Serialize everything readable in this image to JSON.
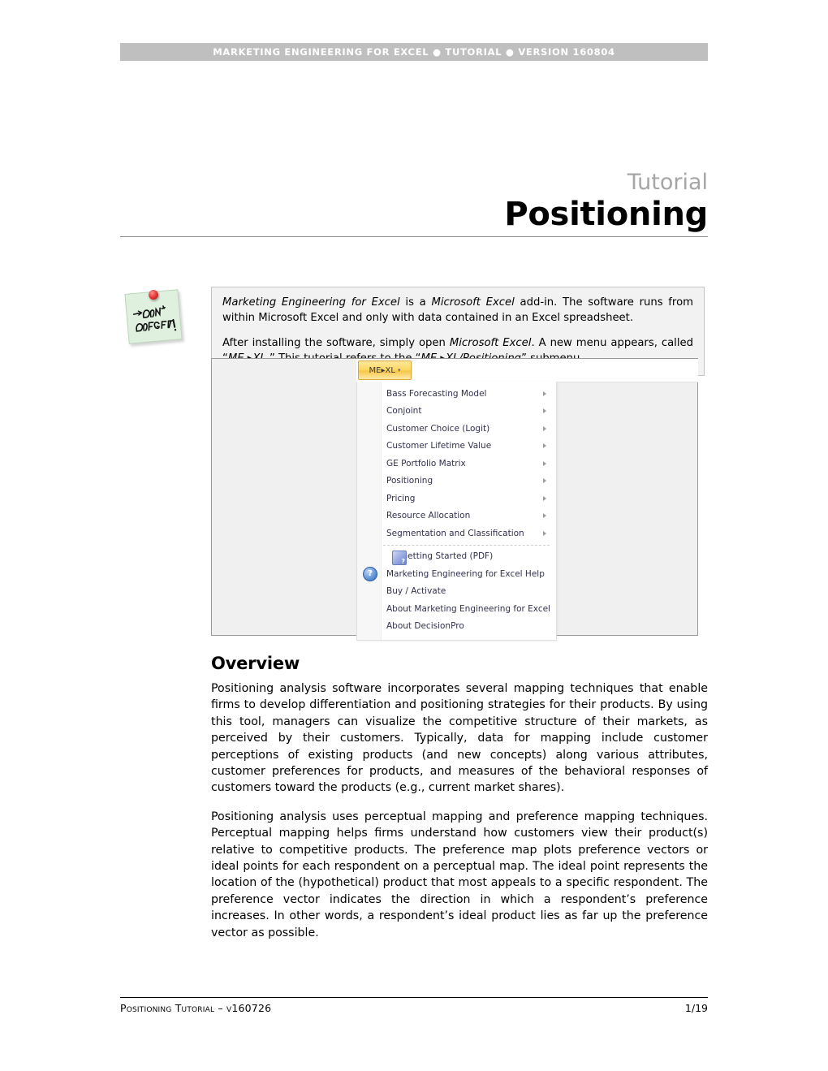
{
  "header": {
    "running_title": "MARKETING ENGINEERING FOR EXCEL  ●  TUTORIAL  ●  VERSION 160804",
    "bar_color": "#bfbfbf",
    "text_color": "#ffffff"
  },
  "title": {
    "kicker": "Tutorial",
    "main": "Positioning",
    "kicker_color": "#a6a6a6",
    "main_color": "#000000"
  },
  "note": {
    "icon_name": "dont-forget-sticky-note",
    "icon_text_line1": "DON'T",
    "icon_text_line2": "FORGET!",
    "paragraph_1_pre": "",
    "paragraph_1": {
      "i1": "Marketing Engineering for Excel",
      "t1": " is a ",
      "i2": "Microsoft Excel",
      "t2": " add-in. The software runs from within Microsoft Excel and only with data contained in an Excel spreadsheet."
    },
    "paragraph_2": {
      "t1": "After installing the software, simply open ",
      "i1": "Microsoft Excel",
      "t2": ". A new menu appears, called “",
      "i2": "ME ▸XL.",
      "t3": "” This tutorial refers to the “",
      "i3": "ME ▸XL/Positioning",
      "t4": "” submenu."
    }
  },
  "screenshot": {
    "name": "excel-me-xl-menu-screenshot",
    "ribbon_button": {
      "label": "ME▸XL",
      "caret": "▾"
    },
    "menu_items_group1": [
      {
        "label": "Bass Forecasting Model",
        "has_submenu": true
      },
      {
        "label": "Conjoint",
        "has_submenu": true
      },
      {
        "label": "Customer Choice (Logit)",
        "has_submenu": true
      },
      {
        "label": "Customer Lifetime Value",
        "has_submenu": true
      },
      {
        "label": "GE Portfolio Matrix",
        "has_submenu": true
      },
      {
        "label": "Positioning",
        "has_submenu": true
      },
      {
        "label": "Pricing",
        "has_submenu": true
      },
      {
        "label": "Resource Allocation",
        "has_submenu": true
      },
      {
        "label": "Segmentation and Classification",
        "has_submenu": true
      }
    ],
    "menu_items_group2": [
      {
        "label": "Getting Started (PDF)",
        "icon": "pdf-book-icon",
        "has_submenu": false
      },
      {
        "label": "Marketing Engineering for Excel Help",
        "icon": "help-question-icon",
        "has_submenu": false
      },
      {
        "label": "Buy / Activate",
        "icon": "",
        "has_submenu": false
      },
      {
        "label": "About Marketing Engineering for Excel",
        "icon": "",
        "has_submenu": false
      },
      {
        "label": "About DecisionPro",
        "icon": "",
        "has_submenu": false
      }
    ]
  },
  "overview": {
    "heading": "Overview",
    "paragraph_1": "Positioning analysis software incorporates several mapping techniques that enable firms to develop differentiation and positioning strategies for their products. By using this tool, managers can visualize the competitive structure of their markets, as perceived by their customers. Typically, data for mapping include customer perceptions of existing products (and new concepts) along various attributes, customer preferences for products, and measures of the behavioral responses of customers toward the products (e.g., current market shares).",
    "paragraph_2": "Positioning analysis uses perceptual mapping and preference mapping techniques. Perceptual mapping helps firms understand how customers view their product(s) relative to competitive products. The preference map plots preference vectors or ideal points for each respondent on a perceptual map. The ideal point represents the location of the (hypothetical) product that most appeals to a specific respondent. The preference vector indicates the direction in which a respondent’s preference increases. In other words, a respondent’s ideal product lies as far up the preference vector as possible."
  },
  "footer": {
    "left": "Positioning Tutorial – v160726",
    "right": "1/19"
  }
}
